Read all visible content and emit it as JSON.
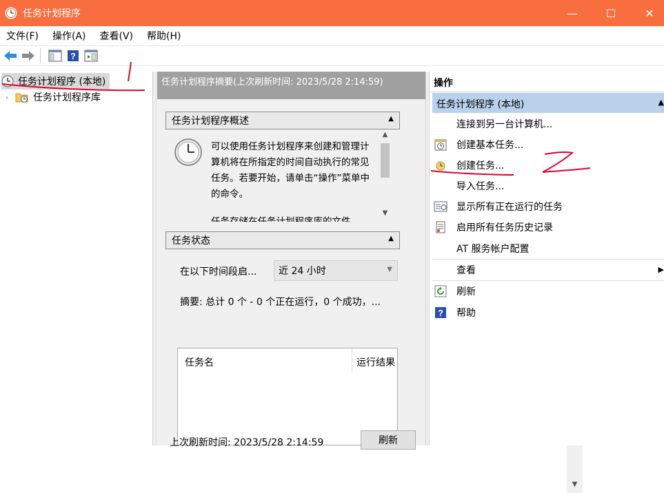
{
  "window": {
    "title": "任务计划程序",
    "minimize": "—",
    "maximize": "☐",
    "close": "✕"
  },
  "menu": [
    {
      "label": "文件(F)"
    },
    {
      "label": "操作(A)"
    },
    {
      "label": "查看(V)"
    },
    {
      "label": "帮助(H)"
    }
  ],
  "tree": {
    "root": "任务计划程序 (本地)",
    "child": "任务计划程序库",
    "expand_glyph": "›"
  },
  "center": {
    "header": "任务计划程序摘要(上次刷新时间: 2023/5/28 2:14:59)",
    "overview": {
      "title": "任务计划程序概述",
      "text": "可以使用任务计划程序来创建和管理计算机将在所指定的时间自动执行的常见任务。若要开始，请单击“操作”菜单中的命令。",
      "more": "任务存储在任务计划程序库的文件"
    },
    "status": {
      "title": "任务状态",
      "period_label": "在以下时间段启...",
      "period_value": "近 24 小时",
      "summary": "摘要: 总计 0 个 - 0 个正在运行，0 个成功，...",
      "columns": [
        "任务名",
        "运行结果"
      ]
    },
    "footer": {
      "last_refresh": "上次刷新时间: 2023/5/28 2:14:59",
      "refresh": "刷新"
    }
  },
  "actions": {
    "title": "操作",
    "group": "任务计划程序 (本地)",
    "items": [
      {
        "label": "连接到另一台计算机...",
        "icon": ""
      },
      {
        "label": "创建基本任务...",
        "icon": "basic-task-icon"
      },
      {
        "label": "创建任务...",
        "icon": "create-task-icon"
      },
      {
        "label": "导入任务...",
        "icon": ""
      },
      {
        "label": "显示所有正在运行的任务",
        "icon": "running-tasks-icon"
      },
      {
        "label": "启用所有任务历史记录",
        "icon": "history-icon"
      },
      {
        "label": "AT 服务帐户配置",
        "icon": ""
      },
      {
        "label": "查看",
        "icon": ""
      },
      {
        "label": "刷新",
        "icon": "refresh-icon"
      },
      {
        "label": "帮助",
        "icon": "help-icon"
      }
    ]
  },
  "colors": {
    "titlebar": "#f96e3f",
    "selection": "#b9d1ea",
    "annotation": "#e0002a"
  },
  "annotations": [
    "1",
    "2"
  ]
}
